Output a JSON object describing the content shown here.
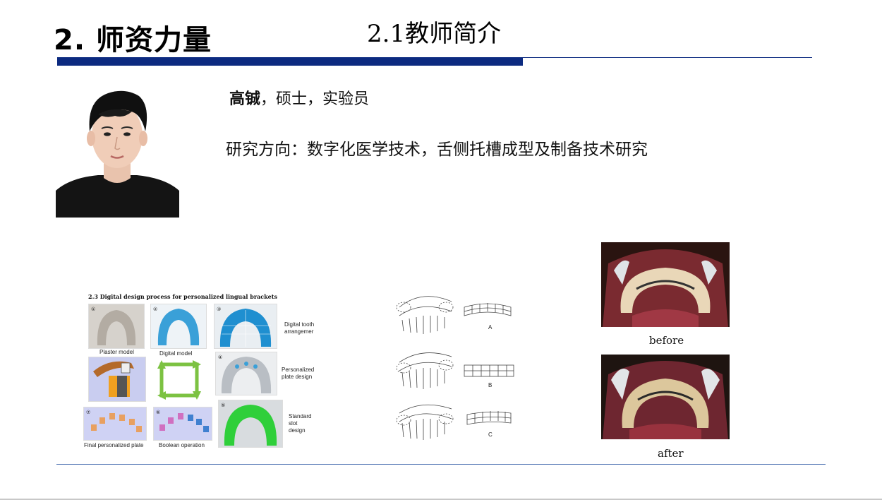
{
  "header": {
    "section_title": "2. 师资力量",
    "subsection_title": "2.1教师简介",
    "accent_color": "#0c2a80"
  },
  "profile": {
    "name": "高铖",
    "credentials": "，硕士，实验员",
    "research": "研究方向：数字化医学技术，舌侧托槽成型及制备技术研究"
  },
  "figure_process": {
    "title": "2.3 Digital design process for personalized lingual brackets",
    "captions": {
      "plaster_model": "Plaster model",
      "digital_model": "Digital model",
      "digital_tooth": "Digital tooth",
      "arrangemer": "arrangemer",
      "personalized": "Personalized",
      "plate_design": "plate design",
      "standard": "Standard",
      "slot": "slot",
      "design": "design",
      "final_plate": "Final personalized plate",
      "boolean": "Boolean operation"
    }
  },
  "figure_arch": {
    "labels": [
      "A",
      "B",
      "C"
    ]
  },
  "clinical_photos": {
    "before_label": "before",
    "after_label": "after"
  }
}
